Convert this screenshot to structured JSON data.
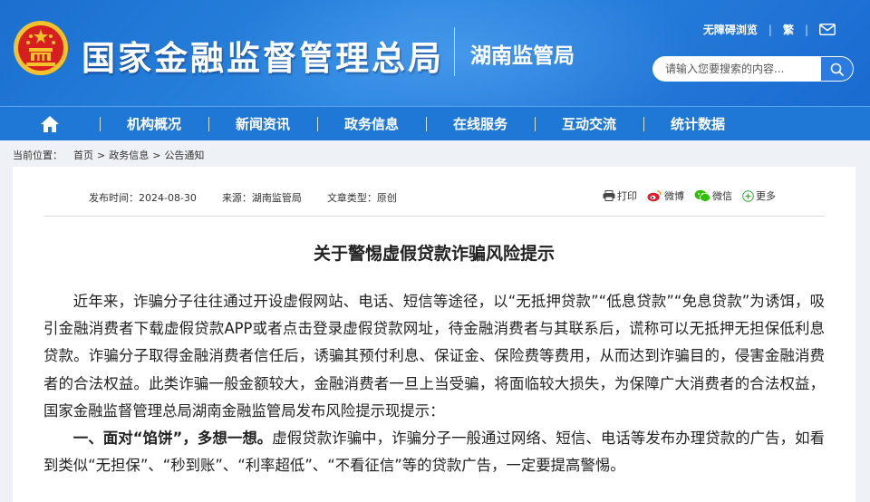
{
  "header": {
    "site_title": "国家金融监督管理总局",
    "sub_title": "湖南监管局",
    "accessibility_link": "无障碍浏览",
    "traditional_link": "繁",
    "search_placeholder": "请输入您要搜索的内容..."
  },
  "nav": {
    "items": [
      "机构概况",
      "新闻资讯",
      "政务信息",
      "在线服务",
      "互动交流",
      "统计数据"
    ]
  },
  "breadcrumb": {
    "prefix": "当前位置：",
    "items": [
      "首页",
      "政务信息",
      "公告通知"
    ],
    "separator": ">"
  },
  "article": {
    "meta": {
      "publish_time": "发布时间：2024-08-30",
      "source": "来源：湖南监管局",
      "type": "文章类型：原创"
    },
    "share": {
      "print": "打印",
      "weibo": "微博",
      "wechat": "微信",
      "more": "更多"
    },
    "title": "关于警惕虚假贷款诈骗风险提示",
    "paragraph1": "近年来，诈骗分子往往通过开设虚假网站、电话、短信等途径，以“无抵押贷款”“低息贷款”“免息贷款”为诱饵，吸引金融消费者下载虚假贷款APP或者点击登录虚假贷款网址，待金融消费者与其联系后，谎称可以无抵押无担保低利息贷款。诈骗分子取得金融消费者信任后，诱骗其预付利息、保证金、保险费等费用，从而达到诈骗目的，侵害金融消费者的合法权益。此类诈骗一般金额较大，金融消费者一旦上当受骗，将面临较大损失，为保障广大消费者的合法权益，国家金融监督管理总局湖南金融监管局发布风险提示现提示：",
    "paragraph2_bold": "一、面对“馅饼”，多想一想。",
    "paragraph2_text": "虚假贷款诈骗中，诈骗分子一般通过网络、短信、电话等发布办理贷款的广告，如看到类似“无担保”、“秒到账”、“利率超低”、“不看征信”等的贷款广告，一定要提高警惕。"
  },
  "colors": {
    "header_blue": "#1b6fcf",
    "nav_blue": "#1f78d6",
    "emblem_red": "#d71f1f",
    "emblem_gold": "#f4c22b"
  }
}
